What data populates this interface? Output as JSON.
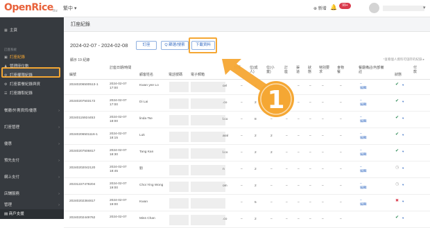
{
  "topbar": {
    "logo": "OpenRice",
    "logo_sub": "Biz",
    "region": "繁中 ▾",
    "new": "⊕ 新增",
    "badge": "99+"
  },
  "sidebar": {
    "home": "主頁",
    "section_restaurant": "訂座系統",
    "items": [
      "訂座紀錄",
      "管理座位數",
      "訂座權限紀錄",
      "訂座套餐紀錄與資",
      "訂座讀取紀錄"
    ],
    "groups": [
      "餐廳/外賣資訊/優惠",
      "訂座管理",
      "優惠",
      "預先支付",
      "網上支付",
      "店舗服務",
      "管理"
    ],
    "bottom": "商戶支援"
  },
  "main": {
    "page_title": "訂座紀錄",
    "date_range": "2024-02-07 - 2024-02-08",
    "btn_booking": "訂座",
    "btn_filter": "Q 篩選/搜索",
    "btn_download": "下載資料",
    "records": "顯示 19 紀錄",
    "note": "*查看個人資料可儲存的紀錄 ▸",
    "headers": [
      "編號",
      "訂座日期/時間",
      "顧客姓名",
      "電話號碼",
      "電子郵箱",
      "分傳",
      "位(成人)",
      "位(小童)",
      "訂座",
      "渠道",
      "狀態",
      "特別要求",
      "食物餐",
      "餐廳備註/內部備註",
      "狀態",
      "付款"
    ],
    "rows": [
      {
        "id": "20240206500513-1",
        "dt": "2024-02-07\n17:00",
        "name": "Kwan yee Lo",
        "em": "cel",
        "pax": "2",
        "dash1": "–",
        "dash2": "–",
        "note": "–\n編輯"
      },
      {
        "id": "20240207503172",
        "dt": "2024-02-07\n17:00",
        "name": "Di Lai",
        "em": ".co",
        "pax": "2",
        "dash1": "–",
        "dash2": "–",
        "note": "–\n編輯"
      },
      {
        "id": "20240115924453",
        "dt": "2024-02-07\n18:00",
        "name": "linda Tse",
        "em": "l.co",
        "pax": "8",
        "dash1": "–",
        "dash2": "–",
        "note": "–\n編輯"
      },
      {
        "id": "20240206501116-1",
        "dt": "2024-02-07\n18:15",
        "name": "Luk",
        "em": "aral",
        "pax": "2",
        "dash1": "2",
        "dash2": "–",
        "note": "–\n編輯"
      },
      {
        "id": "20240207506817",
        "dt": "2024-02-07\n18:30",
        "name": "Tang Kan",
        "em": "l.co",
        "pax": "2",
        "dash1": "2",
        "dash2": "–",
        "note": "–\n編輯"
      },
      {
        "id": "20240202042120",
        "dt": "2024-02-07\n18:45",
        "name": "劉",
        "em": "n",
        "pax": "2",
        "dash1": "–",
        "dash2": "–",
        "note": "–\n編輯"
      },
      {
        "id": "20231227478204",
        "dt": "2024-02-07\n19:00",
        "name": "Choi Ying Wong",
        "em": "om",
        "pax": "2",
        "dash1": "–",
        "dash2": "–",
        "note": "–\n編輯"
      },
      {
        "id": "20240202384817",
        "dt": "2024-02-07\n19:00",
        "name": "Kwan",
        "em": "",
        "pax": "5",
        "dash1": "–",
        "dash2": "–",
        "note": "–\n編輯"
      },
      {
        "id": "20240202449762",
        "dt": "2024-02-07",
        "name": "Miss Chan",
        "em": ".co",
        "pax": "2",
        "dash1": "–",
        "dash2": "–",
        "note": ""
      }
    ],
    "tip_num": "1"
  },
  "colors": {
    "accent": "#f5a733",
    "brand": "#e8623b",
    "link": "#3a6fc4",
    "sidebar": "#363a3f"
  }
}
